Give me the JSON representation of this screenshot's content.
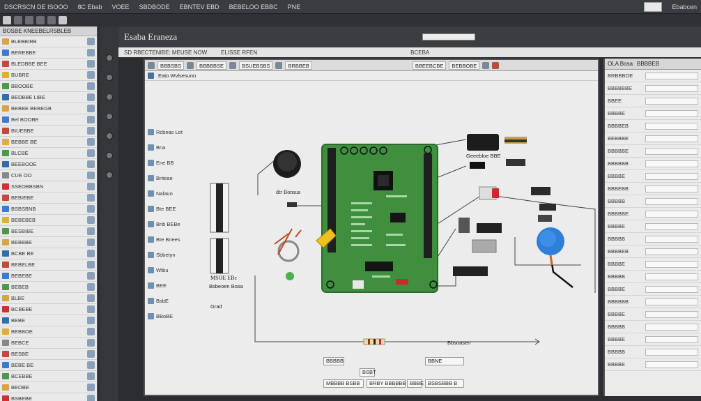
{
  "window": {
    "title_segments": [
      "DSCRSCN DE ISOOO",
      "8C Ebab",
      "VOEE",
      "SBDBODE",
      "EBNTEV EBD",
      "BEBELOO EBBC",
      "PNE"
    ],
    "right_label": "Ebabcen"
  },
  "app": {
    "title": "Esaba Eraneza",
    "subheader": [
      "SD RBECTENIBE: MEUSE NOW",
      "ELISSE RFEN",
      "BCEBA"
    ],
    "header_chip": ""
  },
  "left_panel": {
    "header": "BOSBE KNEEBELRSBLEB",
    "items": [
      {
        "label": "BLEBBIRB",
        "color": "#d9a441"
      },
      {
        "label": "BEREBBE",
        "color": "#3a7bd5"
      },
      {
        "label": "BLEDBBE BEE",
        "color": "#c24a3a"
      },
      {
        "label": "BUBRE",
        "color": "#e0b030"
      },
      {
        "label": "BBOOBE",
        "color": "#4a9a4a"
      },
      {
        "label": "BEDBBE LIBE",
        "color": "#2f6fb0"
      },
      {
        "label": "BEBBE BEBEGB",
        "color": "#d9a441"
      },
      {
        "label": "Bel BOOBE",
        "color": "#3a7bd5"
      },
      {
        "label": "BIUEBBE",
        "color": "#c24a3a"
      },
      {
        "label": "BEBBE BE",
        "color": "#e0b030"
      },
      {
        "label": "BLCBE",
        "color": "#4a9a4a"
      },
      {
        "label": "BEEBOOE",
        "color": "#2f6fb0"
      },
      {
        "label": "CUE OO",
        "color": "#888888"
      },
      {
        "label": "SSEOBBSBN",
        "color": "#d03030"
      },
      {
        "label": "BEBIEBE",
        "color": "#c24a3a"
      },
      {
        "label": "BSBSBNB",
        "color": "#3a7bd5"
      },
      {
        "label": "BEBEBEB",
        "color": "#e0b030"
      },
      {
        "label": "BESBIBE",
        "color": "#4a9a4a"
      },
      {
        "label": "BEBBBE",
        "color": "#d9a441"
      },
      {
        "label": "BCBE BE",
        "color": "#2f6fb0"
      },
      {
        "label": "BEBELBE",
        "color": "#c24a3a"
      },
      {
        "label": "BEBEBE",
        "color": "#3a7bd5"
      },
      {
        "label": "BEBEB",
        "color": "#4a9a4a"
      },
      {
        "label": "BLBE",
        "color": "#d9a441"
      },
      {
        "label": "BCBEBE",
        "color": "#d03030"
      },
      {
        "label": "BEBE",
        "color": "#2f6fb0"
      },
      {
        "label": "BEBBOE",
        "color": "#e0b030"
      },
      {
        "label": "BEBCE",
        "color": "#888888"
      },
      {
        "label": "BESBE",
        "color": "#c24a3a"
      },
      {
        "label": "BEBE BE",
        "color": "#3a7bd5"
      },
      {
        "label": "BCEBBE",
        "color": "#4a9a4a"
      },
      {
        "label": "BEOBE",
        "color": "#d9a441"
      },
      {
        "label": "BSBEBE",
        "color": "#d03030"
      }
    ]
  },
  "canvas_window": {
    "toolbar_labels": [
      "BBBSBS",
      "BBBBBSE",
      "BSUEBSBS",
      "BRBBEB",
      "BBEEBCBE",
      "BEBBOBE"
    ],
    "subbar_label": "Eato Wvlsesunn",
    "components": [
      "Rcbeas Lot",
      "Bna",
      "Ene BB",
      "Bnteae",
      "Nalauo",
      "Bte BEE",
      "Bnb BEBe",
      "Bte Bnees",
      "Sbbetyn",
      "Wtbu",
      "BEE",
      "BsbE",
      "BBoBE"
    ],
    "schematic_labels": {
      "board_top": "Geeebloe BBE",
      "buzzer": "dtr Bonsua",
      "left_block": "MSOE EBc",
      "left_sub": "Bsbeoen Bosa",
      "left_sub2": "Grad",
      "resistor": "Bbsoasen"
    },
    "status_fields": [
      "BBBBB",
      "BSBT",
      "BBNE",
      "MBBBB BSBB",
      "BRBY BBBBBB",
      "BBBE",
      "BSBSBBB B"
    ]
  },
  "right_panel": {
    "header": [
      "OLA Bosa",
      "BBBBEB"
    ],
    "rows": [
      {
        "key": "BRBBBOE",
        "value": ""
      },
      {
        "key": "BBBBBBE",
        "value": ""
      },
      {
        "key": "BBEE",
        "value": ""
      },
      {
        "key": "BBBBE",
        "value": ""
      },
      {
        "key": "BBBBEB",
        "value": ""
      },
      {
        "key": "BEBBBE",
        "value": ""
      },
      {
        "key": "BBBBBE",
        "value": ""
      },
      {
        "key": "BBBBBB",
        "value": ""
      },
      {
        "key": "BBBBE",
        "value": ""
      },
      {
        "key": "BBBEBB",
        "value": ""
      },
      {
        "key": "BBBBB",
        "value": ""
      },
      {
        "key": "BBBBBE",
        "value": ""
      },
      {
        "key": "BBBBE",
        "value": ""
      },
      {
        "key": "BBBBB",
        "value": ""
      },
      {
        "key": "BBBBEB",
        "value": ""
      },
      {
        "key": "BBBBE",
        "value": ""
      },
      {
        "key": "BBBBB",
        "value": ""
      },
      {
        "key": "BBBBE",
        "value": ""
      },
      {
        "key": "BBBBBB",
        "value": ""
      },
      {
        "key": "BBBBE",
        "value": ""
      },
      {
        "key": "BBBBB",
        "value": ""
      },
      {
        "key": "BBBBE",
        "value": ""
      },
      {
        "key": "BBBBB",
        "value": ""
      },
      {
        "key": "BBBBE",
        "value": ""
      }
    ]
  },
  "colors": {
    "pcb_green": "#3f8f3f",
    "accent_blue": "#2f7fd6",
    "accent_yellow": "#f0c020",
    "red": "#cc2a2a"
  }
}
